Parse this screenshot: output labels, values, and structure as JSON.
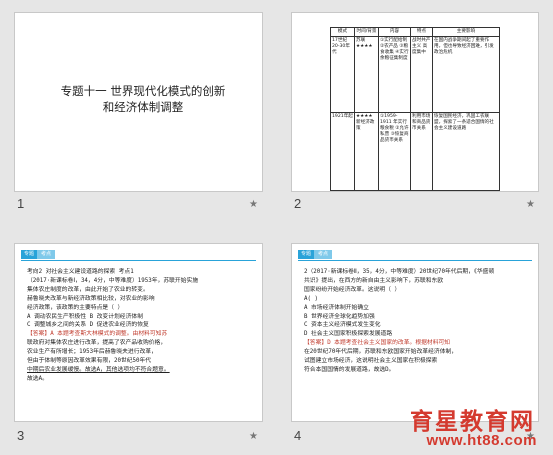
{
  "slides": [
    {
      "number": "1",
      "title_line1": "专题十一   世界现代化模式的创新",
      "title_line2": "和经济体制调整"
    },
    {
      "number": "2",
      "table": {
        "headers": [
          "模式",
          "时间/背景",
          "内容",
          "特点",
          "主要影响"
        ],
        "rows": [
          [
            "17世纪 20-30年代",
            "苏联 ★★★★",
            "①实行配给制 ②农产品 ③粮食收集 ④实行余粮征集制度",
            "战时共产主义 高度集中",
            "在国内战争期间起了重要作用，但也导致经济困难，引发政治危机"
          ],
          [
            "1921年起",
            "★★★★ 新经济政策",
            "①1959-1911 年实行粮食税 ②允许私营 ③恢复商品货币关系",
            "利用市场和商品货币关系",
            "恢复国民经济，巩固工农联盟，探索了一条适合国情的社会主义建设道路"
          ]
        ]
      },
      "star": "★"
    },
    {
      "number": "3",
      "badge": [
        "专题",
        "考点"
      ],
      "lines": [
        "考向2 对社会主义建设道路的探索 考点1",
        "（2017·新课标卷Ⅰ，34，4分，中等难度）1953年，苏联开始实施",
        "集体农庄制度的改革，由此开始了农业的转变。",
        "赫鲁晓夫改革与新经济政策相比较，对农业的影响",
        "经济政策，该政策的主要特点是（    ）",
        "A 调动农民生产积极性 B 改变计划经济体制",
        "C 调整城乡之间的关系 D 促进农业经济的恢复",
        "【答案】A 本题考查斯大林模式的调整。由材料可知苏",
        "联政府对集体农庄进行改革，提高了农产品收购价格，",
        "农业生产有所增长；1953年后赫鲁晓夫进行改革，",
        "但由于体制等原因改革效果有限，20世纪50年代",
        "中期后农业发展缓慢。故选A，其他选项均不符合题意。",
        "故选A。"
      ],
      "star": "★"
    },
    {
      "number": "4",
      "badge": [
        "专题",
        "考点"
      ],
      "lines": [
        "2（2017·新课标卷Ⅱ，35，4分，中等难度）20世纪70年代后期，《华盛顿",
        "共识》提出，在西方的新自由主义影响下，苏联和东欧",
        "国家纷纷开始经济改革。这说明（     ）",
        "A(      )",
        "A 市场经济体制开始确立",
        "B 世界经济全球化趋势加强",
        "C 资本主义经济模式发生变化",
        "D 社会主义国家积极探索发展道路",
        "【答案】D 本题考查社会主义国家的改革。根据材料可知",
        "在20世纪70年代后期，苏联和东欧国家开始改革经济体制，",
        "试图建立市场经济，这说明社会主义国家在积极探索",
        "符合本国国情的发展道路，故选D。"
      ],
      "star": "★"
    }
  ],
  "watermark": {
    "cn": "育星教育网",
    "url": "www.ht88.com"
  }
}
